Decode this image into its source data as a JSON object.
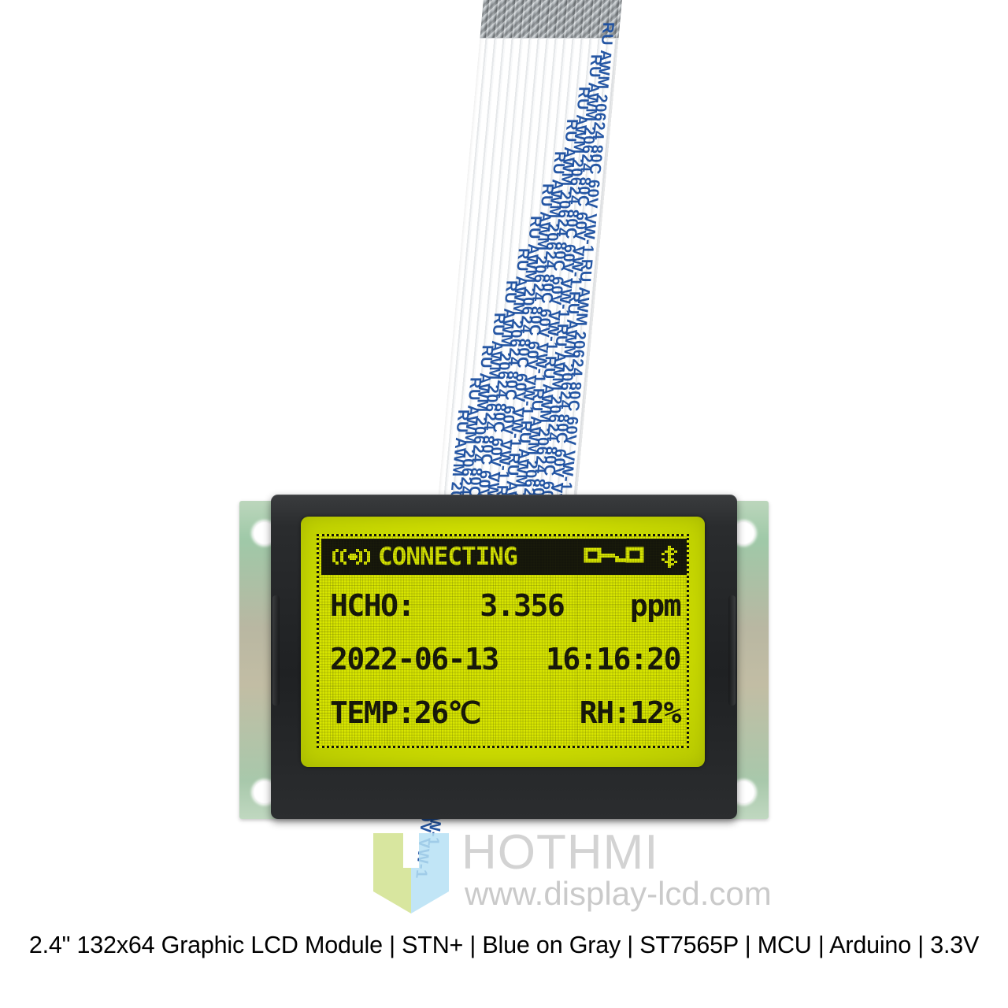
{
  "product": {
    "caption": "2.4\" 132x64 Graphic LCD Module | STN+ | Blue on Gray | ST7565P | MCU | Arduino | 3.3V"
  },
  "cable": {
    "marking": "RU  AWM  20624  80C  60V  VW-1",
    "repeat_count": 13
  },
  "lcd": {
    "status_bar": {
      "signal_icon": "wireless-broadcast-icon",
      "title": "CONNECTING",
      "link_icon": "link-connection-icon",
      "bluetooth_icon": "bluetooth-icon"
    },
    "rows": [
      {
        "name": "hcho-reading",
        "left": "HCHO:",
        "center": "3.356",
        "right": "ppm"
      },
      {
        "name": "datetime",
        "left": "2022-06-13",
        "center": "",
        "right": "16:16:20"
      },
      {
        "name": "environment",
        "left": "TEMP:26℃",
        "center": "",
        "right": "RH:12%"
      }
    ]
  },
  "watermark": {
    "brand": "HOTHMI",
    "url": "www.display-lcd.com",
    "logo_colors": {
      "left": "#cfe08a",
      "right": "#b6e1f5"
    }
  },
  "colors": {
    "lcd_background": "#d8e600",
    "lcd_pixel": "#15160a",
    "bezel": "#232527",
    "pcb": "#aec9a8",
    "cable_text": "#1b4fa0"
  }
}
